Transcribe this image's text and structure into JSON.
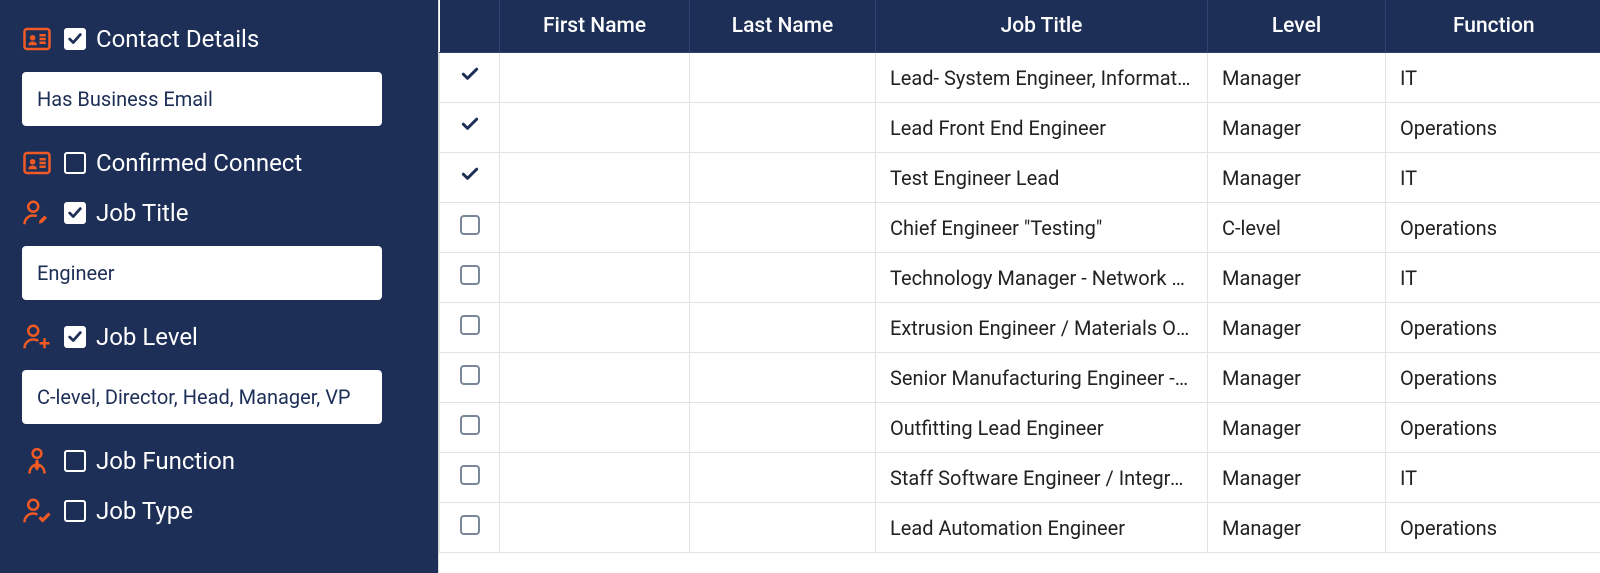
{
  "colors": {
    "accent": "#f15a24",
    "navy": "#1d2f56"
  },
  "sidebar": {
    "filters": [
      {
        "key": "contact-details",
        "label": "Contact Details",
        "checked": true,
        "icon": "contact-card-icon",
        "input_value": "Has Business Email"
      },
      {
        "key": "confirmed-connect",
        "label": "Confirmed Connect",
        "checked": false,
        "icon": "contact-card-icon",
        "input_value": null
      },
      {
        "key": "job-title",
        "label": "Job Title",
        "checked": true,
        "icon": "person-edit-icon",
        "input_value": "Engineer"
      },
      {
        "key": "job-level",
        "label": "Job Level",
        "checked": true,
        "icon": "person-plus-icon",
        "input_value": "C-level, Director, Head, Manager, VP"
      },
      {
        "key": "job-function",
        "label": "Job Function",
        "checked": false,
        "icon": "person-tie-icon",
        "input_value": null
      },
      {
        "key": "job-type",
        "label": "Job Type",
        "checked": false,
        "icon": "person-check-icon",
        "input_value": null
      }
    ]
  },
  "table": {
    "columns": [
      "",
      "First Name",
      "Last Name",
      "Job Title",
      "Level",
      "Function"
    ],
    "rows": [
      {
        "checked": true,
        "first_name": "",
        "last_name": "",
        "job_title": "Lead- System Engineer, Informati...",
        "level": "Manager",
        "function": "IT"
      },
      {
        "checked": true,
        "first_name": "",
        "last_name": "",
        "job_title": "Lead Front End Engineer",
        "level": "Manager",
        "function": "Operations"
      },
      {
        "checked": true,
        "first_name": "",
        "last_name": "",
        "job_title": "Test Engineer Lead",
        "level": "Manager",
        "function": "IT"
      },
      {
        "checked": false,
        "first_name": "",
        "last_name": "",
        "job_title": "Chief Engineer \"Testing\"",
        "level": "C-level",
        "function": "Operations"
      },
      {
        "checked": false,
        "first_name": "",
        "last_name": "",
        "job_title": "Technology Manager - Network &...",
        "level": "Manager",
        "function": "IT"
      },
      {
        "checked": false,
        "first_name": "",
        "last_name": "",
        "job_title": "Extrusion Engineer / Materials Off...",
        "level": "Manager",
        "function": "Operations"
      },
      {
        "checked": false,
        "first_name": "",
        "last_name": "",
        "job_title": "Senior Manufacturing Engineer - I...",
        "level": "Manager",
        "function": "Operations"
      },
      {
        "checked": false,
        "first_name": "",
        "last_name": "",
        "job_title": "Outfitting Lead Engineer",
        "level": "Manager",
        "function": "Operations"
      },
      {
        "checked": false,
        "first_name": "",
        "last_name": "",
        "job_title": "Staff Software Engineer / Integrat...",
        "level": "Manager",
        "function": "IT"
      },
      {
        "checked": false,
        "first_name": "",
        "last_name": "",
        "job_title": "Lead Automation Engineer",
        "level": "Manager",
        "function": "Operations"
      }
    ]
  }
}
